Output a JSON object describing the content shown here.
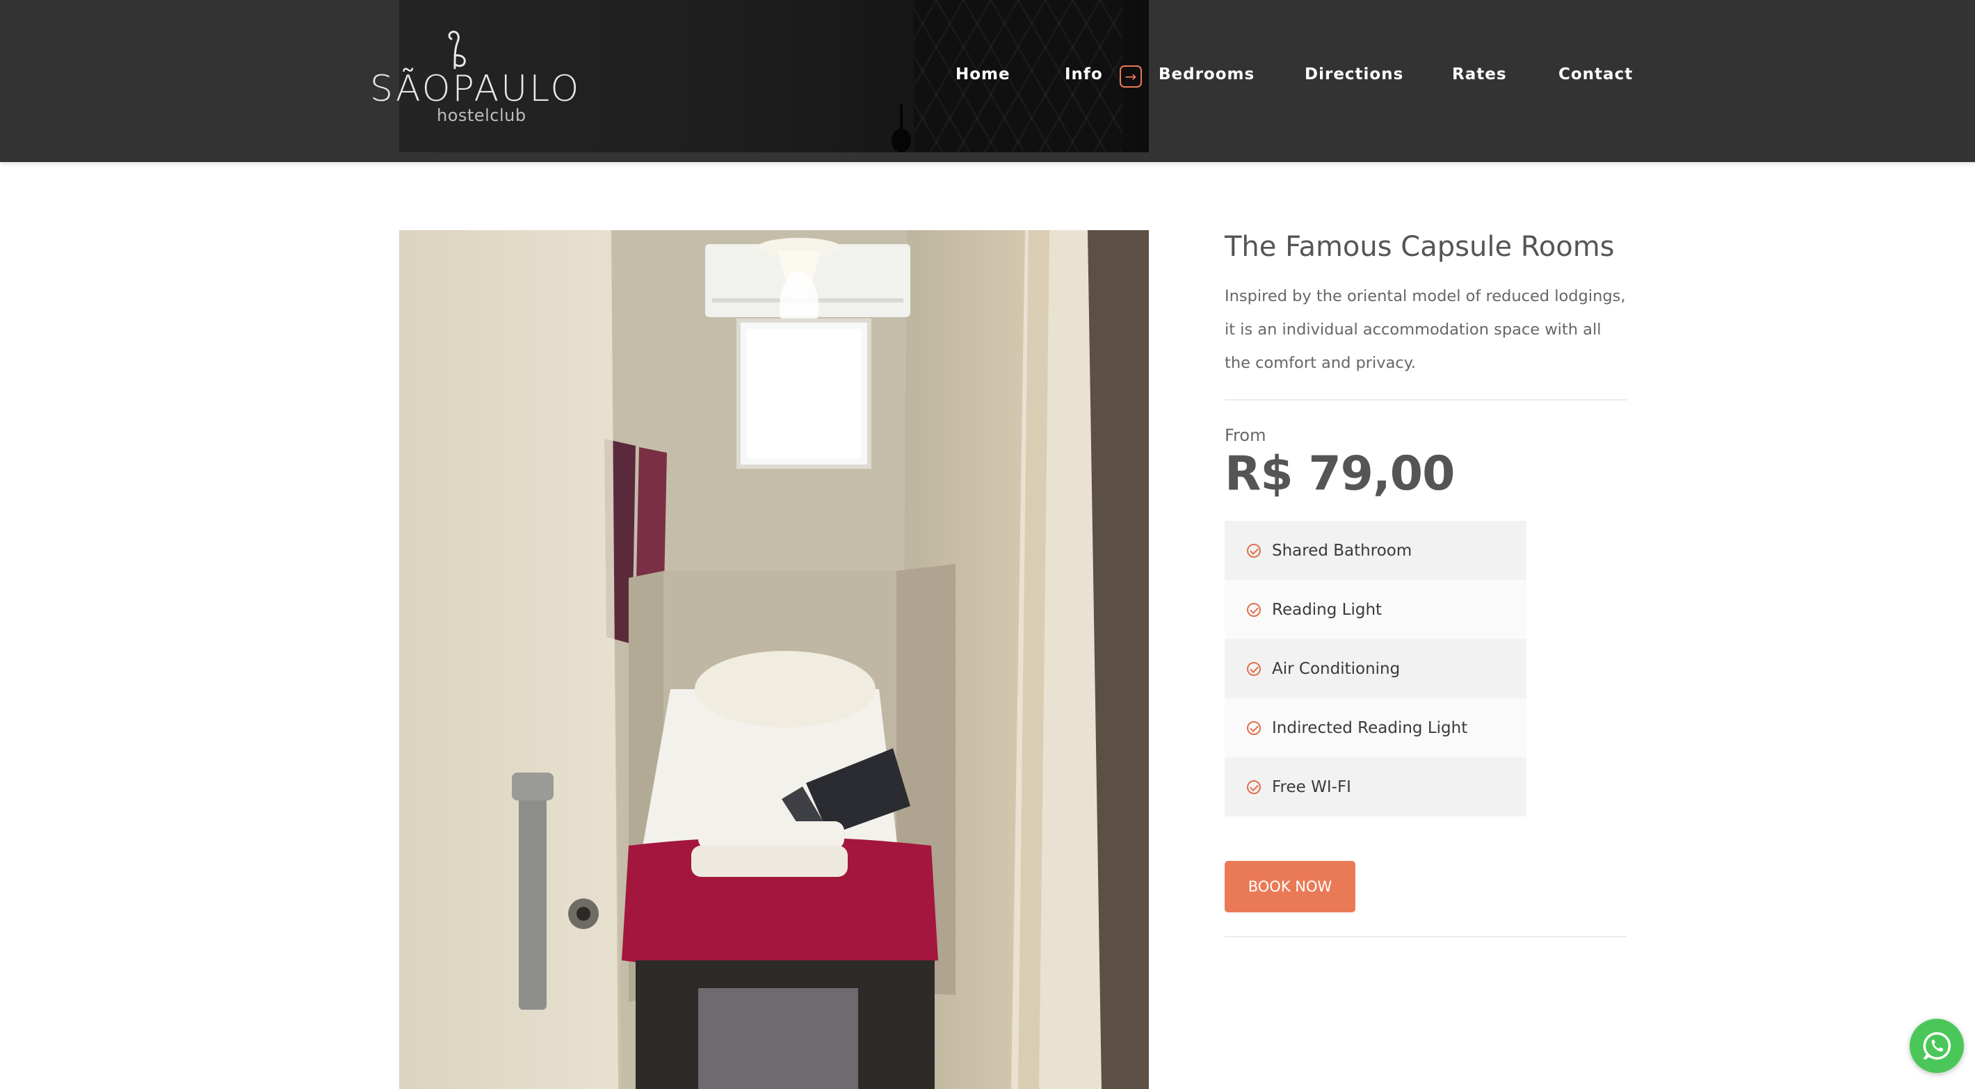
{
  "logo": {
    "main_text": "SÃOPAULO",
    "sub_text": "hostelclub"
  },
  "nav": {
    "items": [
      {
        "label": "Home"
      },
      {
        "label": "Info"
      },
      {
        "label": "Bedrooms"
      },
      {
        "label": "Directions"
      },
      {
        "label": "Rates"
      },
      {
        "label": "Contact"
      }
    ],
    "arrow_icon": "arrow-right-icon"
  },
  "room": {
    "title": "The Famous Capsule Rooms",
    "description": "Inspired by the oriental model of reduced lodgings, it is an individual accommodation space with all the comfort and privacy.",
    "from_label": "From",
    "price": "R$ 79,00",
    "features": [
      {
        "label": "Shared Bathroom",
        "icon": "check-circle-icon"
      },
      {
        "label": "Reading Light",
        "icon": "check-circle-icon"
      },
      {
        "label": "Air Conditioning",
        "icon": "check-circle-icon"
      },
      {
        "label": "Indirected Reading Light",
        "icon": "check-circle-icon"
      },
      {
        "label": "Free WI-FI",
        "icon": "check-circle-icon"
      }
    ],
    "book_label": "BOOK NOW"
  },
  "whatsapp": {
    "icon": "whatsapp-icon"
  },
  "colors": {
    "header_bg": "#333333",
    "accent": "#ea7a57",
    "whatsapp": "#4bc75a",
    "text_dark": "#555555"
  }
}
